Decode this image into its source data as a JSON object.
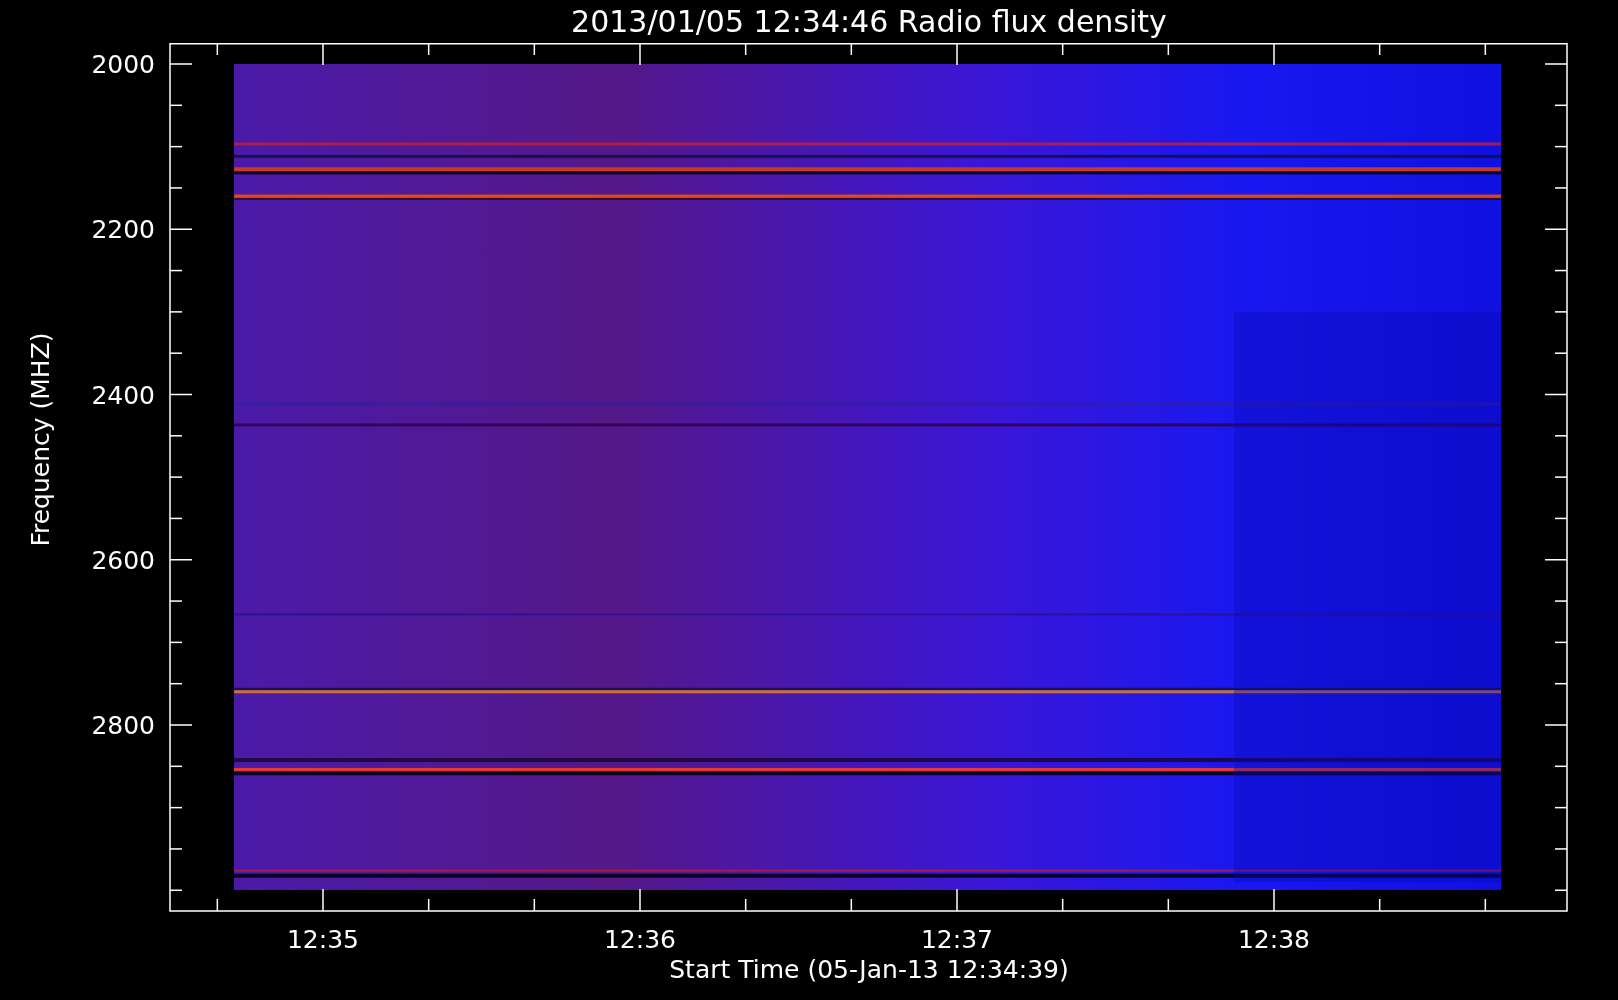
{
  "title": "2013/01/05 12:34:46 Radio flux density",
  "y_axis": {
    "label": "Frequency (MHZ)",
    "ticks": [
      "2000",
      "2200",
      "2400",
      "2600",
      "2800"
    ]
  },
  "x_axis": {
    "label": "Start Time (05-Jan-13 12:34:39)",
    "ticks": [
      "12:35",
      "12:36",
      "12:37",
      "12:38"
    ]
  }
}
